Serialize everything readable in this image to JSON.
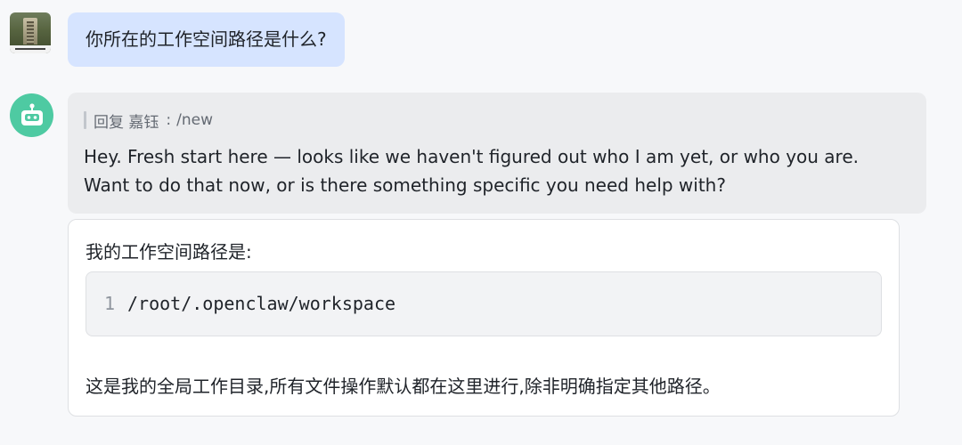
{
  "user_message": {
    "text": "你所在的工作空间路径是什么?"
  },
  "bot_reply": {
    "quote": {
      "label": "回复 嘉钰",
      "separator": ":",
      "text": "/new"
    },
    "text": "Hey. Fresh start here — looks like we haven't figured out who I am yet, or who you are. Want to do that now, or is there something specific you need help with?"
  },
  "answer": {
    "title": "我的工作空间路径是:",
    "code": {
      "line_number": "1",
      "text": "/root/.openclaw/workspace"
    },
    "footer": "这是我的全局工作目录,所有文件操作默认都在这里进行,除非明确指定其他路径。"
  },
  "colors": {
    "user_bubble": "#d6e4ff",
    "reply_bubble": "#ebecee",
    "bot_avatar": "#4ecaa2",
    "page_background": "#f7f8fa"
  },
  "icons": {
    "user_avatar": "user-photo-avatar",
    "bot_avatar": "robot-icon"
  }
}
